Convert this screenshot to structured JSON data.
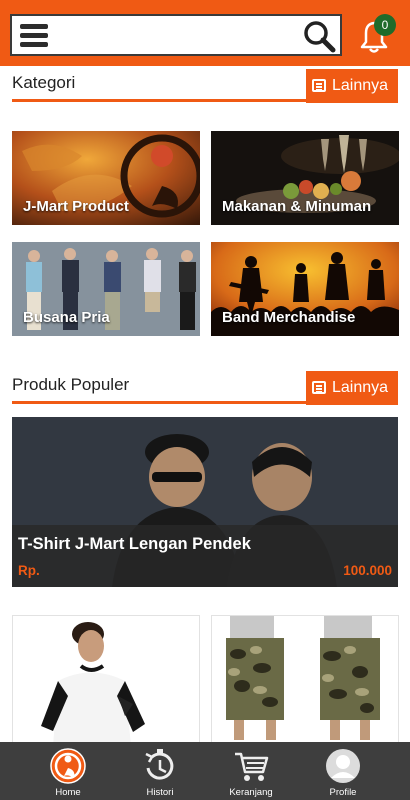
{
  "header": {
    "menu_icon": "hamburger-menu-icon",
    "search": {
      "value": "",
      "placeholder": ""
    },
    "search_icon": "magnifier-icon",
    "notification_icon": "bell-icon",
    "notification_count": "0"
  },
  "kategori": {
    "title": "Kategori",
    "more_label": "Lainnya",
    "items": [
      {
        "label": "J-Mart Product"
      },
      {
        "label": "Makanan & Minuman"
      },
      {
        "label": "Busana Pria"
      },
      {
        "label": "Band Merchandise"
      }
    ]
  },
  "populer": {
    "title": "Produk Populer",
    "more_label": "Lainnya",
    "featured": {
      "name": "T-Shirt J-Mart Lengan Pendek",
      "currency": "Rp.",
      "price": "100.000"
    }
  },
  "bottom_nav": [
    {
      "label": "Home",
      "icon": "home-logo-icon"
    },
    {
      "label": "Histori",
      "icon": "history-timer-icon"
    },
    {
      "label": "Keranjang",
      "icon": "cart-icon"
    },
    {
      "label": "Profile",
      "icon": "profile-avatar-icon"
    }
  ],
  "colors": {
    "accent": "#f05a14",
    "nav_bg": "#3e3e3e",
    "badge": "#1f6b2a"
  }
}
